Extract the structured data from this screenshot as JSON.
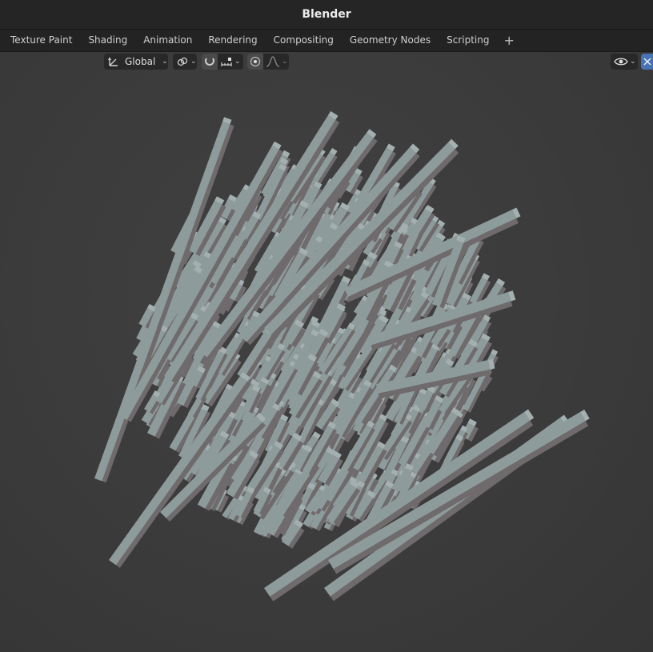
{
  "app": {
    "title": "Blender"
  },
  "tabs": [
    {
      "label": "Texture Paint"
    },
    {
      "label": "Shading"
    },
    {
      "label": "Animation"
    },
    {
      "label": "Rendering"
    },
    {
      "label": "Compositing"
    },
    {
      "label": "Geometry Nodes"
    },
    {
      "label": "Scripting"
    }
  ],
  "add_tab_label": "+",
  "header": {
    "transform_orientation": "Global",
    "icons": {
      "orientation": "transform-orientation-icon",
      "pivot": "pivot-point-icon",
      "snap": "snap-magnet-icon",
      "snap_target": "snap-increment-icon",
      "proportional": "proportional-editing-icon",
      "falloff": "falloff-curve-icon",
      "visibility": "eye-icon",
      "gizmo": "gizmo-icon"
    }
  },
  "colors": {
    "face_light": "#8e9b9b",
    "face_side": "#6f6a6b",
    "face_top": "#a4b0b0",
    "viewport_bg": "#3a3a3a",
    "accent": "#4772b3"
  }
}
